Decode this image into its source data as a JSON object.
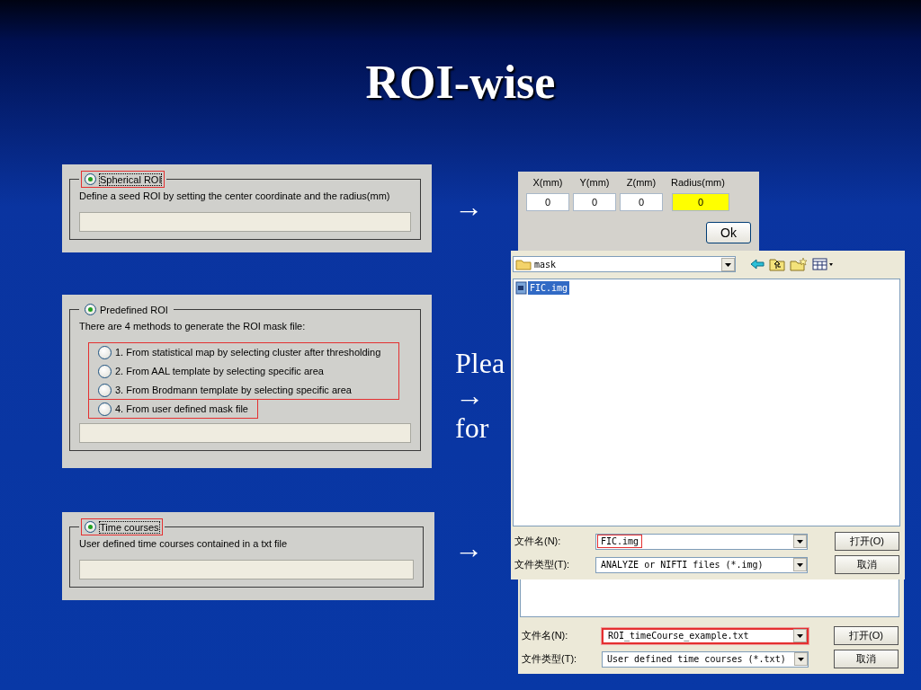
{
  "title": "ROI-wise",
  "panels": [
    {
      "kind": "simple",
      "title": "Spherical ROI",
      "selected": true,
      "focused": true,
      "highlighted": true,
      "description": "Define a seed ROI by setting the center coordinate and the radius(mm)"
    },
    {
      "kind": "options",
      "title": "Predefined ROI",
      "selected": true,
      "focused": false,
      "highlighted": false,
      "description": "There are 4 methods to generate the ROI mask file:",
      "option_groups": [
        {
          "highlighted": true,
          "options": [
            {
              "label": "1. From statistical map by selecting cluster after thresholding",
              "selected": false
            },
            {
              "label": "2. From AAL template by selecting specific area",
              "selected": false
            },
            {
              "label": "3. From Brodmann template by selecting specific area",
              "selected": false
            }
          ]
        },
        {
          "highlighted": true,
          "options": [
            {
              "label": "4. From user defined mask file",
              "selected": false
            }
          ]
        }
      ]
    },
    {
      "kind": "simple",
      "title": "Time courses",
      "selected": true,
      "focused": true,
      "highlighted": true,
      "description": "User defined time courses contained in a txt file"
    }
  ],
  "arrows": [
    "→",
    "→"
  ],
  "note": {
    "lines": [
      "Plea",
      "→",
      "for"
    ]
  },
  "coordinate_dialog": {
    "fields": [
      {
        "label": "X(mm)",
        "value": "0",
        "highlighted": false
      },
      {
        "label": "Y(mm)",
        "value": "0",
        "highlighted": false
      },
      {
        "label": "Z(mm)",
        "value": "0",
        "highlighted": false
      },
      {
        "label": "Radius(mm)",
        "value": "0",
        "highlighted": true
      }
    ],
    "button": "Ok"
  },
  "mask_dialog": {
    "look_in": "mask",
    "files": [
      {
        "name": "FIC.img",
        "selected": true
      }
    ],
    "rows": [
      {
        "label": "文件名(N):",
        "value": "FIC.img",
        "highlighted": true
      },
      {
        "label": "文件类型(T):",
        "value": "ANALYZE or NIFTI files (*.img)",
        "highlighted": false
      }
    ],
    "buttons": [
      "打开(O)",
      "取消"
    ]
  },
  "timecourse_dialog": {
    "rows": [
      {
        "label": "文件名(N):",
        "value": "ROI_timeCourse_example.txt",
        "highlighted": true
      },
      {
        "label": "文件类型(T):",
        "value": "User defined time courses (*.txt)",
        "highlighted": false
      }
    ],
    "buttons": [
      "打开(O)",
      "取消"
    ]
  }
}
